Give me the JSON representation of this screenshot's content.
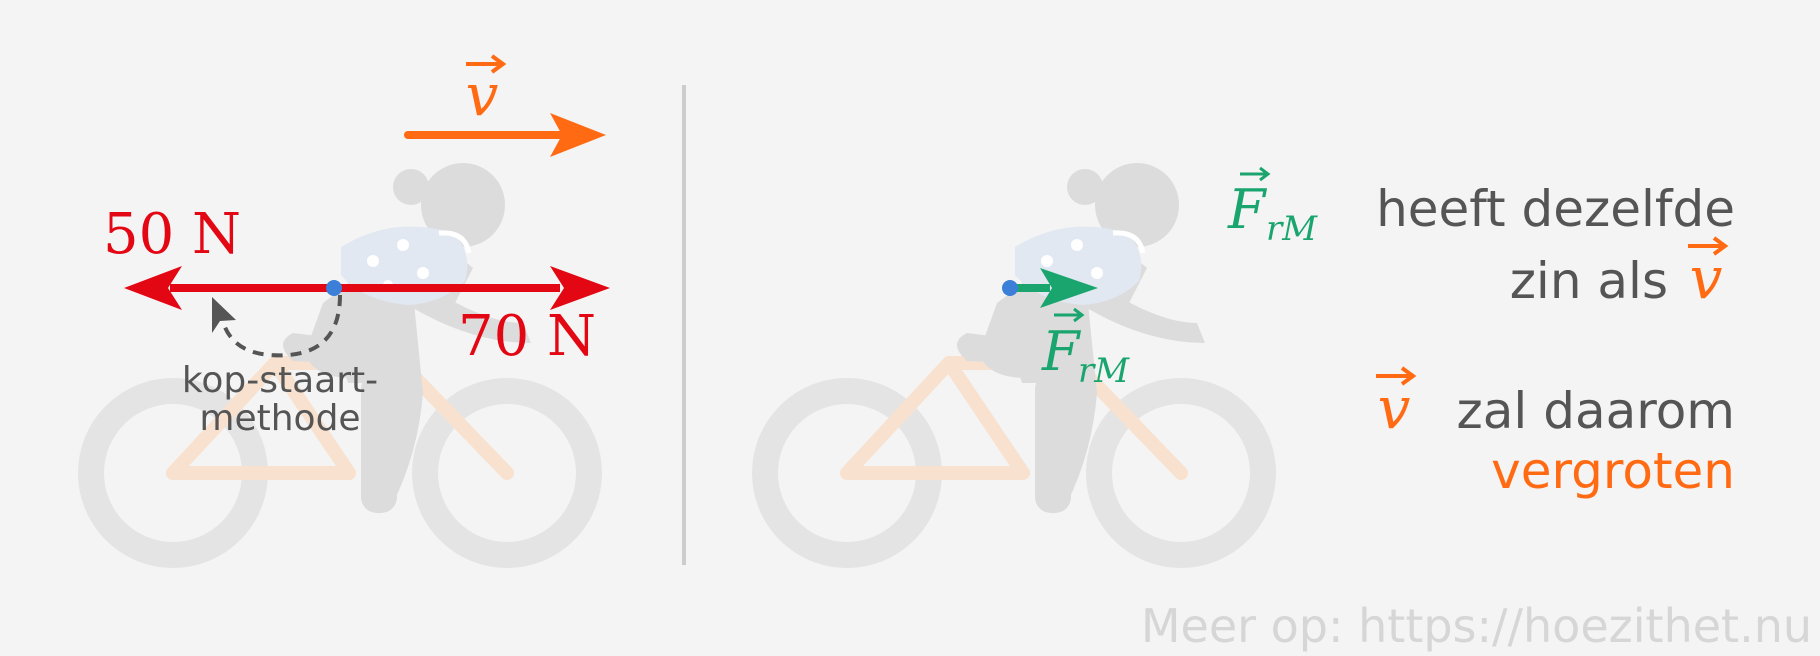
{
  "colors": {
    "background": "#f4f4f4",
    "velocity": "#ff6a13",
    "force": "#e30613",
    "resultant": "#1aa56f",
    "point": "#3b7fd9",
    "figure": "#dcdcdc",
    "wheel": "#e4e4e4",
    "bike_frame": "#f8e2cf",
    "divider": "#cccccc",
    "text": "#555555",
    "watermark": "#d6d6d6"
  },
  "left": {
    "velocity_symbol": "v",
    "force_left_label": "50 N",
    "force_right_label": "70 N",
    "method_label_line1": "kop-staart-",
    "method_label_line2": "methode"
  },
  "right": {
    "resultant_main": "F",
    "resultant_sub": "rM",
    "statement1_text_a": "heeft dezelfde",
    "statement1_text_b": "zin als",
    "statement1_symbol": "v",
    "statement2_symbol": "v",
    "statement2_text_a": "zal daarom",
    "statement2_text_b": "vergroten"
  },
  "footer": {
    "watermark": "Meer op: https://hoezithet.nu"
  }
}
